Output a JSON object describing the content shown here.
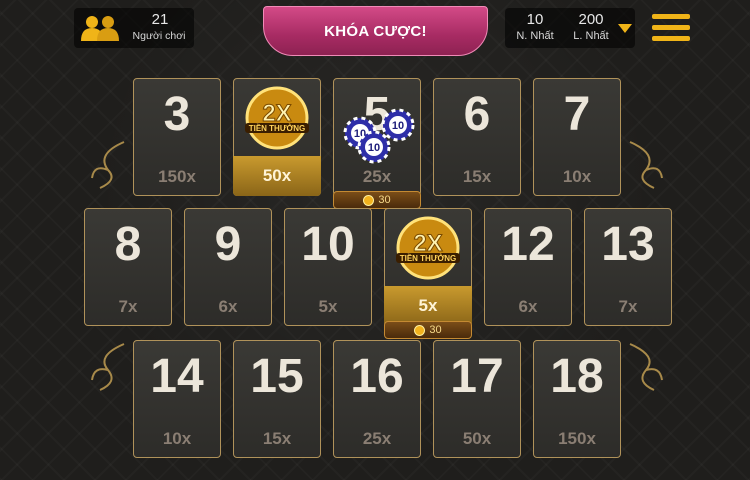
{
  "top": {
    "players_count": "21",
    "players_label": "Người chơi",
    "lock_button": "KHÓA CƯỢC!",
    "min_value": "10",
    "min_label": "N. Nhất",
    "max_value": "200",
    "max_label": "L. Nhất"
  },
  "badge_text": "2X",
  "badge_subtext": "TIỀN THƯỞNG",
  "chip_value": "10",
  "colors": {
    "gold": "#f0b418",
    "pink": "#c23a77",
    "cell_border": "#b0925a"
  },
  "rows": [
    [
      {
        "num": "3",
        "odds": "150x"
      },
      {
        "num": "",
        "odds": "50x",
        "bonus": true
      },
      {
        "num": "5",
        "odds": "25x",
        "chips": true,
        "bet": "30"
      },
      {
        "num": "6",
        "odds": "15x"
      },
      {
        "num": "7",
        "odds": "10x"
      }
    ],
    [
      {
        "num": "8",
        "odds": "7x"
      },
      {
        "num": "9",
        "odds": "6x"
      },
      {
        "num": "10",
        "odds": "5x"
      },
      {
        "num": "",
        "odds": "5x",
        "bonus": true,
        "bet": "30"
      },
      {
        "num": "12",
        "odds": "6x"
      },
      {
        "num": "13",
        "odds": "7x"
      }
    ],
    [
      {
        "num": "14",
        "odds": "10x"
      },
      {
        "num": "15",
        "odds": "15x"
      },
      {
        "num": "16",
        "odds": "25x"
      },
      {
        "num": "17",
        "odds": "50x"
      },
      {
        "num": "18",
        "odds": "150x"
      }
    ]
  ]
}
